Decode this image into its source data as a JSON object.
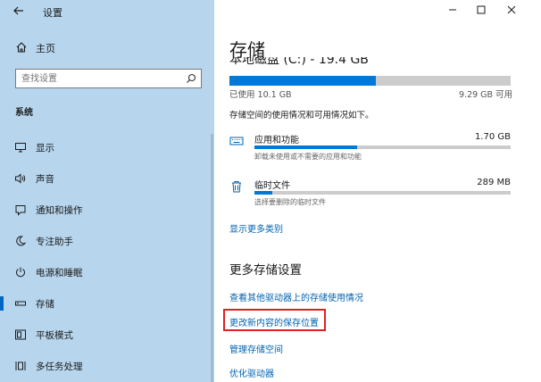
{
  "app": {
    "title": "设置"
  },
  "sidebar": {
    "home_label": "主页",
    "search_placeholder": "查找设置",
    "section_label": "系统",
    "items": [
      {
        "label": "显示",
        "icon": "monitor-icon"
      },
      {
        "label": "声音",
        "icon": "speaker-icon"
      },
      {
        "label": "通知和操作",
        "icon": "notification-icon"
      },
      {
        "label": "专注助手",
        "icon": "moon-icon"
      },
      {
        "label": "电源和睡眠",
        "icon": "power-icon"
      },
      {
        "label": "存储",
        "icon": "storage-icon",
        "active": true
      },
      {
        "label": "平板模式",
        "icon": "tablet-icon"
      },
      {
        "label": "多任务处理",
        "icon": "multitask-icon"
      }
    ]
  },
  "main": {
    "title": "存储",
    "drive_title": "本地磁盘 (C:) - 19.4 GB",
    "used_label": "已使用 10.1 GB",
    "available_label": "9.29 GB 可用",
    "usage_fraction": 0.52,
    "description": "存储空间的使用情况和可用情况如下。",
    "categories": [
      {
        "name": "应用和功能",
        "size": "1.70 GB",
        "sub": "卸载未使用或不需要的应用和功能",
        "fraction": 0.4,
        "icon": "keyboard-icon"
      },
      {
        "name": "临时文件",
        "size": "289 MB",
        "sub": "选择要删除的临时文件",
        "fraction": 0.07,
        "icon": "trash-icon"
      }
    ],
    "show_more_link": "显示更多类别",
    "more_settings_title": "更多存储设置",
    "links": [
      "查看其他驱动器上的存储使用情况",
      "更改新内容的保存位置",
      "管理存储空间",
      "优化驱动器"
    ]
  },
  "colors": {
    "accent": "#0078d7",
    "link": "#0063b1",
    "sidebar_bg": "#b7d6ee",
    "highlight": "#e02020"
  }
}
